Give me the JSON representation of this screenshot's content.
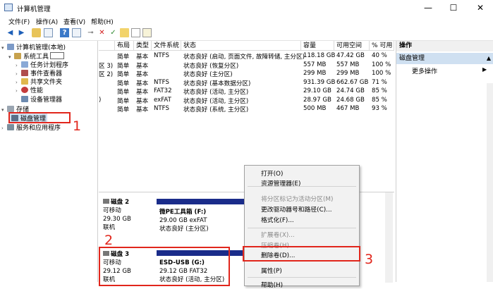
{
  "window": {
    "title": "计算机管理",
    "btn_min": "—",
    "btn_max": "☐",
    "btn_close": "✕"
  },
  "menu": [
    "文件(F)",
    "操作(A)",
    "查看(V)",
    "帮助(H)"
  ],
  "toolbar": [
    "back-icon",
    "forward-icon",
    "folder-icon",
    "grid-icon",
    "help-icon",
    "pane-icon",
    "key-icon",
    "delete-icon",
    "check-icon",
    "page-icon",
    "search-icon",
    "zoom-icon"
  ],
  "tree": {
    "root": "计算机管理(本地)",
    "system_tools": "系统工具",
    "task_scheduler": "任务计划程序",
    "event_viewer": "事件查看器",
    "shared_folders": "共享文件夹",
    "performance": "性能",
    "device_manager": "设备管理器",
    "storage": "存储",
    "disk_management": "磁盘管理",
    "services": "服务和应用程序"
  },
  "list": {
    "headers": [
      "布局",
      "类型",
      "文件系统",
      "状态",
      "容量",
      "可用空间",
      "% 可用"
    ],
    "rows": [
      {
        "prefix": "",
        "layout": "简单",
        "type": "基本",
        "fs": "NTFS",
        "status": "状态良好 (启动, 页面文件, 故障转储, 主分区)",
        "cap": "118.18 GB",
        "free": "47.42 GB",
        "pct": "40 %"
      },
      {
        "prefix": "区 3)",
        "layout": "简单",
        "type": "基本",
        "fs": "",
        "status": "状态良好 (恢复分区)",
        "cap": "557 MB",
        "free": "557 MB",
        "pct": "100 %"
      },
      {
        "prefix": "区 2)",
        "layout": "简单",
        "type": "基本",
        "fs": "",
        "status": "状态良好 (主分区)",
        "cap": "299 MB",
        "free": "299 MB",
        "pct": "100 %"
      },
      {
        "prefix": "",
        "layout": "简单",
        "type": "基本",
        "fs": "NTFS",
        "status": "状态良好 (基本数据分区)",
        "cap": "931.39 GB",
        "free": "662.67 GB",
        "pct": "71 %"
      },
      {
        "prefix": "",
        "layout": "简单",
        "type": "基本",
        "fs": "FAT32",
        "status": "状态良好 (活动, 主分区)",
        "cap": "29.10 GB",
        "free": "24.74 GB",
        "pct": "85 %"
      },
      {
        "prefix": ")",
        "layout": "简单",
        "type": "基本",
        "fs": "exFAT",
        "status": "状态良好 (活动, 主分区)",
        "cap": "28.97 GB",
        "free": "24.68 GB",
        "pct": "85 %"
      },
      {
        "prefix": "",
        "layout": "简单",
        "type": "基本",
        "fs": "NTFS",
        "status": "状态良好 (系统, 主分区)",
        "cap": "500 MB",
        "free": "467 MB",
        "pct": "93 %"
      }
    ]
  },
  "actions": {
    "header": "操作",
    "selected": "磁盘管理",
    "more": "更多操作"
  },
  "disks": [
    {
      "name": "磁盘 2",
      "kind": "可移动",
      "size": "29.30 GB",
      "state": "联机",
      "part_name": "微PE工具箱 (F:)",
      "part_size": "29.00 GB exFAT",
      "part_state": "状态良好 (主分区)"
    },
    {
      "name": "磁盘 3",
      "kind": "可移动",
      "size": "29.12 GB",
      "state": "联机",
      "part_name": "ESD-USB (G:)",
      "part_size": "29.12 GB FAT32",
      "part_state": "状态良好 (活动, 主分区)"
    }
  ],
  "context_menu": [
    {
      "label": "打开(O)",
      "enabled": true
    },
    {
      "label": "资源管理器(E)",
      "enabled": true
    },
    {
      "label": "将分区标记为活动分区(M)",
      "enabled": false
    },
    {
      "label": "更改驱动器号和路径(C)...",
      "enabled": true
    },
    {
      "label": "格式化(F)...",
      "enabled": true
    },
    {
      "label": "扩展卷(X)...",
      "enabled": false
    },
    {
      "label": "压缩卷(H)...",
      "enabled": false
    },
    {
      "label": "删除卷(D)...",
      "enabled": true
    },
    {
      "label": "属性(P)",
      "enabled": true
    },
    {
      "label": "帮助(H)",
      "enabled": true
    }
  ],
  "annotations": [
    "1",
    "2",
    "3"
  ],
  "colors": {
    "accent": "#e1261c",
    "partition_bar": "#1a2c8a",
    "selection": "#cfe0f1"
  }
}
